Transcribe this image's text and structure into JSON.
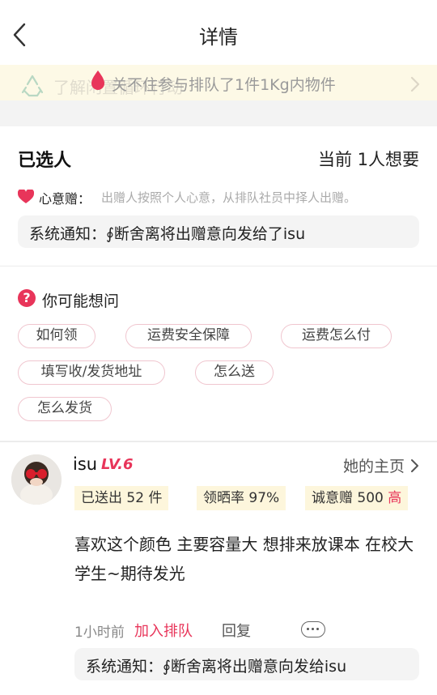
{
  "header": {
    "title": "详情",
    "back_icon": "chevron-left-icon"
  },
  "banner": {
    "notice": "关不住参与排队了1件1Kg内物件",
    "ghost_text": "了解闲置循环行动",
    "icons": [
      "recycle-icon",
      "drop-icon",
      "chevron-right-icon"
    ]
  },
  "selected": {
    "title": "已选人",
    "count": "当前 1人想要",
    "mode_label": "心意赠：",
    "mode_desc": "出赠人按照个人心意，从排队社员中择人出赠。",
    "system_notice": "系统通知：∮断舍离将出赠意向发给了isu"
  },
  "faq": {
    "title": "你可能想问",
    "chips": [
      "如何领",
      "运费安全保障",
      "运费怎么付",
      "填写收/发货地址",
      "怎么送",
      "怎么发货"
    ]
  },
  "user": {
    "name": "isu",
    "level": "LV.6",
    "home_link": "她的主页",
    "stats": {
      "sent": "已送出 52 件",
      "rate": "领晒率 97%",
      "sincerity": "诚意赠 500",
      "sincerity_level": "高"
    },
    "comment": "喜欢这个颜色 主要容量大 想排来放课本 在校大学生~期待发光",
    "time": "1小时前",
    "join_label": "加入排队",
    "reply_label": "回复",
    "system_notice": "系统通知：∮断舍离将出赠意向发给isu"
  },
  "colors": {
    "accent": "#e8355a",
    "banner_bg": "#fdf9e6",
    "stat_bg": "#fdf6dc"
  }
}
